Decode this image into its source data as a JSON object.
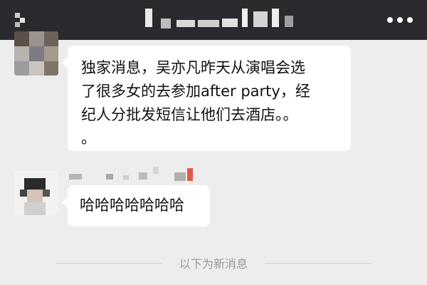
{
  "header": {
    "title": "",
    "back_icon": "back-icon",
    "more_icon": "more-icon"
  },
  "messages": [
    {
      "sender": "",
      "lines": [
        "独家消息，吴亦凡昨天从演唱会选",
        "了很多女的去参加after party，经",
        "纪人分批发短信让他们去酒店。。",
        "。"
      ]
    },
    {
      "sender": "",
      "lines": [
        "哈哈哈哈哈哈哈"
      ]
    }
  ],
  "system_notice": "以下为新消息",
  "colors": {
    "header_bg": "#2a2a2e",
    "chat_bg": "#ededed",
    "bubble_bg": "#ffffff",
    "notice_text": "#9a9a9a"
  }
}
